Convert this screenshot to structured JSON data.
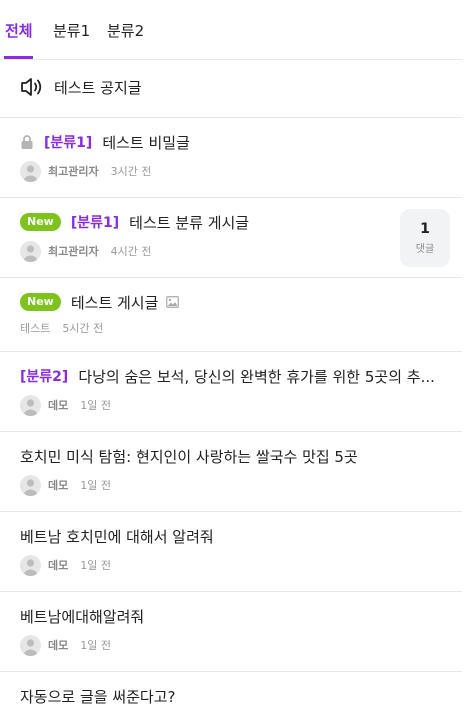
{
  "tabs": [
    {
      "label": "전체",
      "active": true
    },
    {
      "label": "분류1",
      "active": false
    },
    {
      "label": "분류2",
      "active": false
    }
  ],
  "notice": {
    "title": "테스트 공지글",
    "icon": "speaker-icon"
  },
  "posts": [
    {
      "locked": true,
      "category": "[분류1]",
      "title": "테스트 비밀글",
      "author": "최고관리자",
      "time": "3시간 전"
    },
    {
      "is_new": true,
      "new_label": "New",
      "category": "[분류1]",
      "title": "테스트 분류 게시글",
      "author": "최고관리자",
      "time": "4시간 전",
      "comments": {
        "count": "1",
        "label": "댓글"
      }
    },
    {
      "is_new": true,
      "new_label": "New",
      "title": "테스트 게시글",
      "has_image": true,
      "board": "테스트",
      "time": "5시간 전"
    },
    {
      "category": "[분류2]",
      "title": "다낭의 숨은 보석, 당신의 완벽한 휴가를 위한 5곳의 추...",
      "author": "데모",
      "time": "1일 전"
    },
    {
      "title": "호치민 미식 탐험: 현지인이 사랑하는 쌀국수 맛집 5곳",
      "author": "데모",
      "time": "1일 전"
    },
    {
      "title": "베트남 호치민에 대해서 알려줘",
      "author": "데모",
      "time": "1일 전"
    },
    {
      "title": "베트남에대해알려줘",
      "author": "데모",
      "time": "1일 전"
    },
    {
      "title": "자동으로 글을 써준다고?"
    }
  ],
  "colors": {
    "accent": "#8a2be2",
    "new_badge": "#7cc41a"
  }
}
